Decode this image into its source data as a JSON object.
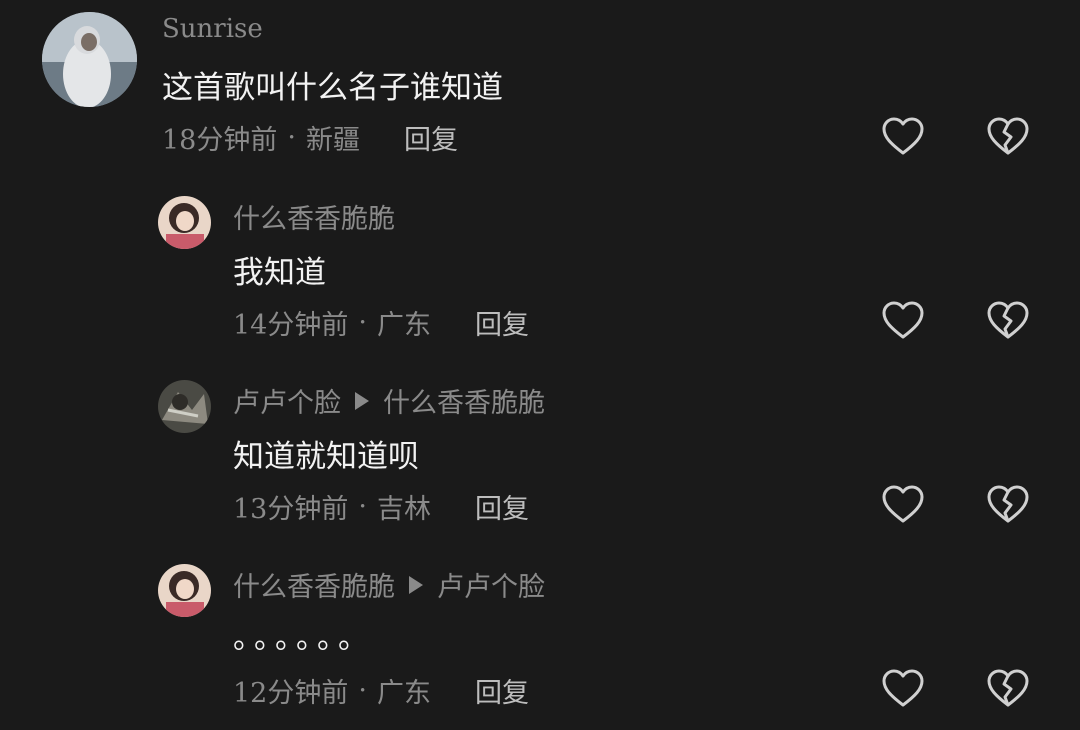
{
  "comments": [
    {
      "username": "Sunrise",
      "reply_to": "",
      "text": "这首歌叫什么名子谁知道",
      "time": "18分钟前",
      "location": "新疆",
      "reply_label": "回复"
    },
    {
      "username": "什么香香脆脆",
      "reply_to": "",
      "text": "我知道",
      "time": "14分钟前",
      "location": "广东",
      "reply_label": "回复"
    },
    {
      "username": "卢卢个脸",
      "reply_to": "什么香香脆脆",
      "text": "知道就知道呗",
      "time": "13分钟前",
      "location": "吉林",
      "reply_label": "回复"
    },
    {
      "username": "什么香香脆脆",
      "reply_to": "卢卢个脸",
      "text": "。。。。。。",
      "time": "12分钟前",
      "location": "广东",
      "reply_label": "回复"
    }
  ],
  "meta_separator": "·",
  "icons": {
    "like": "heart-icon",
    "dislike": "broken-heart-icon"
  },
  "colors": {
    "background": "#1a1a1a",
    "text_primary": "#f2f2f2",
    "text_secondary": "#8a8a8a",
    "icon": "#d0d0d0"
  }
}
